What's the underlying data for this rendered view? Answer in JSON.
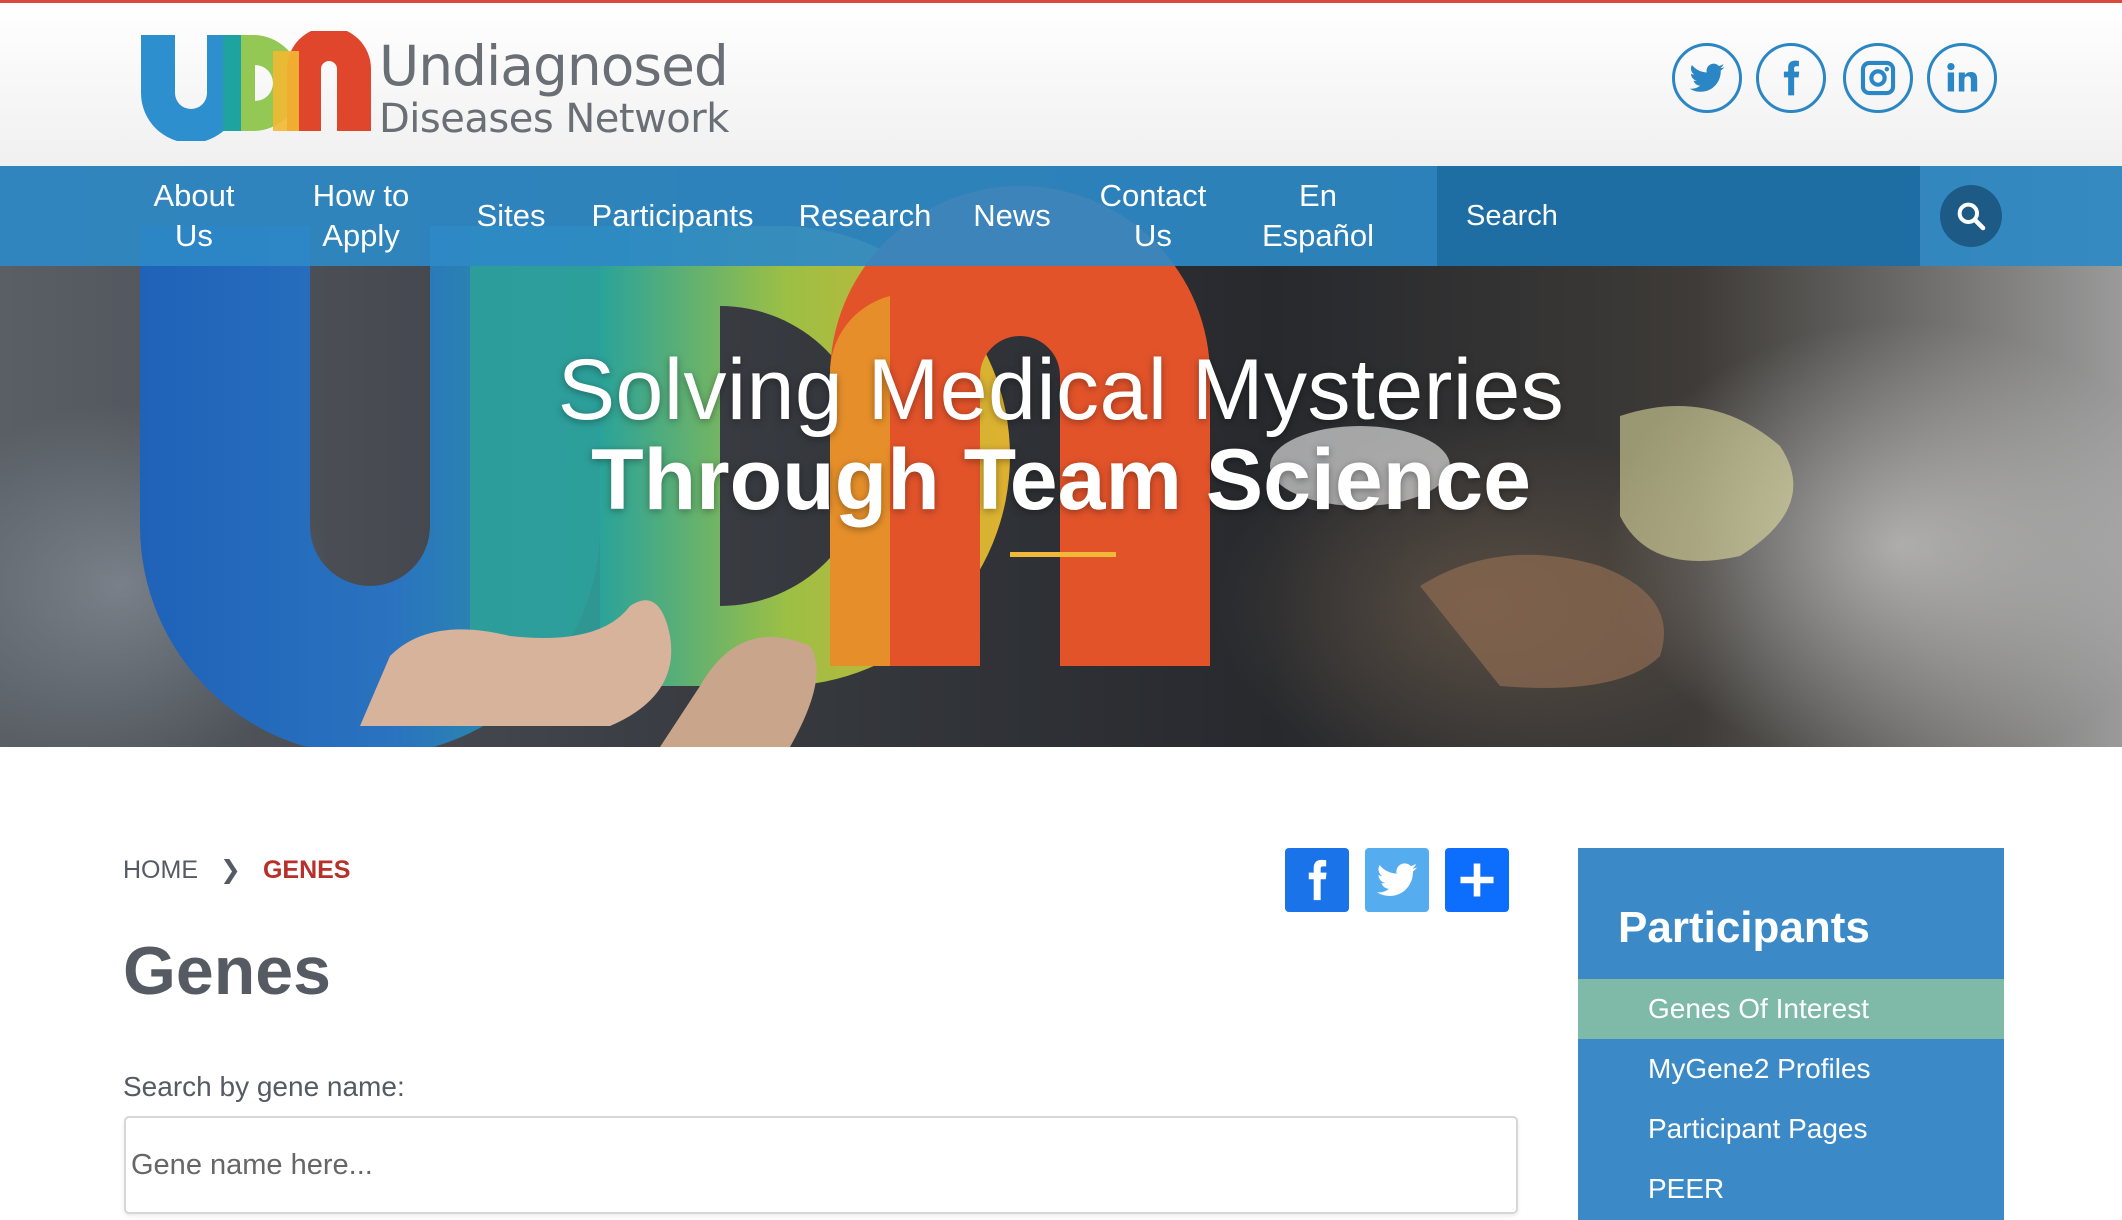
{
  "logo": {
    "line1": "Undiagnosed",
    "line2": "Diseases Network"
  },
  "social": [
    {
      "name": "twitter-icon"
    },
    {
      "name": "facebook-icon"
    },
    {
      "name": "instagram-icon"
    },
    {
      "name": "linkedin-icon"
    }
  ],
  "nav": {
    "items": [
      {
        "label": "About\nUs"
      },
      {
        "label": "How to\nApply"
      },
      {
        "label": "Sites"
      },
      {
        "label": "Participants"
      },
      {
        "label": "Research"
      },
      {
        "label": "News"
      },
      {
        "label": "Contact\nUs"
      },
      {
        "label": "En\nEspañol"
      }
    ],
    "search_placeholder": "Search"
  },
  "hero": {
    "line1": "Solving Medical Mysteries",
    "line2": "Through Team Science"
  },
  "breadcrumb": {
    "home": "HOME",
    "separator": "❯",
    "current": "GENES"
  },
  "page": {
    "title": "Genes",
    "search_label": "Search by gene name:",
    "search_placeholder": "Gene name here..."
  },
  "share": [
    {
      "name": "facebook-share-icon"
    },
    {
      "name": "twitter-share-icon"
    },
    {
      "name": "plus-share-icon"
    }
  ],
  "sidebar": {
    "title": "Participants",
    "items": [
      {
        "label": "Genes Of Interest",
        "active": true
      },
      {
        "label": "MyGene2 Profiles"
      },
      {
        "label": "Participant Pages"
      },
      {
        "label": "PEER"
      }
    ]
  },
  "colors": {
    "brand_blue": "#2e89c5",
    "accent_red": "#b8302a",
    "hero_rule": "#f0b93a",
    "sidebar_active": "#7fb9a8"
  }
}
